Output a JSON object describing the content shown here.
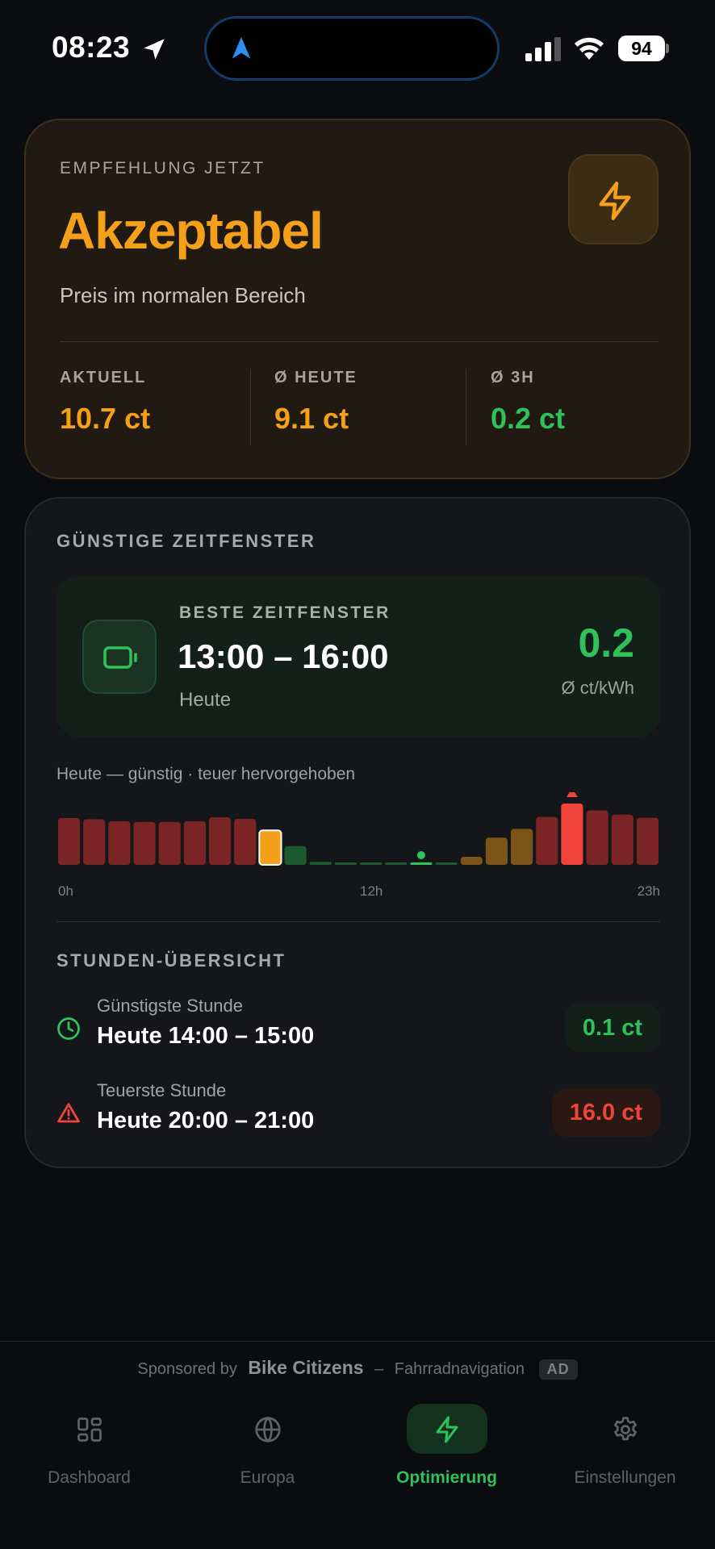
{
  "status_bar": {
    "time": "08:23",
    "battery": "94"
  },
  "recommendation": {
    "label": "EMPFEHLUNG JETZT",
    "status": "Akzeptabel",
    "description": "Preis im normalen Bereich",
    "stats": [
      {
        "label": "AKTUELL",
        "value": "10.7 ct",
        "color": "#f5a01a"
      },
      {
        "label": "Ø HEUTE",
        "value": "9.1 ct",
        "color": "#f5a01a"
      },
      {
        "label": "Ø 3H",
        "value": "0.2 ct",
        "color": "#2fc25a"
      }
    ]
  },
  "windows": {
    "title": "GÜNSTIGE ZEITFENSTER",
    "best": {
      "label": "BESTE ZEITFENSTER",
      "time": "13:00 – 16:00",
      "day": "Heute",
      "value": "0.2",
      "unit": "Ø ct/kWh"
    },
    "chart_caption": "Heute — günstig · teuer hervorgehoben",
    "chart_data": {
      "type": "bar",
      "categories": [
        "0h",
        "1h",
        "2h",
        "3h",
        "4h",
        "5h",
        "6h",
        "7h",
        "8h",
        "9h",
        "10h",
        "11h",
        "12h",
        "13h",
        "14h",
        "15h",
        "16h",
        "17h",
        "18h",
        "19h",
        "20h",
        "21h",
        "22h",
        "23h"
      ],
      "values": [
        12.2,
        11.9,
        11.4,
        11.2,
        11.2,
        11.4,
        12.4,
        12.0,
        9.0,
        4.9,
        0.8,
        0.4,
        0.4,
        0.6,
        0.1,
        0.5,
        2.1,
        7.1,
        9.4,
        12.5,
        16.0,
        14.2,
        13.1,
        12.3
      ],
      "highlight_current": "8h",
      "highlight_cheapest": "14h",
      "highlight_expensive": "20h",
      "x_tick_labels": [
        "0h",
        "12h",
        "23h"
      ],
      "colors": {
        "expensive": "#7a2426",
        "peak": "#f0443a",
        "current": "#f5a01a",
        "mid": "#7a5418",
        "cheap": "#1e5a2f",
        "cheapest": "#2fc25a"
      }
    },
    "hours_title": "STUNDEN-ÜBERSICHT",
    "cheapest": {
      "label": "Günstigste Stunde",
      "time": "Heute 14:00 – 15:00",
      "value": "0.1 ct"
    },
    "expensive": {
      "label": "Teuerste Stunde",
      "time": "Heute 20:00 – 21:00",
      "value": "16.0 ct"
    }
  },
  "sponsor": {
    "prefix": "Sponsored by",
    "brand": "Bike Citizens",
    "dash": "–",
    "tagline": "Fahrradnavigation",
    "ad": "AD"
  },
  "tabs": [
    {
      "label": "Dashboard",
      "icon": "dashboard-icon"
    },
    {
      "label": "Europa",
      "icon": "globe-icon"
    },
    {
      "label": "Optimierung",
      "icon": "bolt-icon",
      "active": true
    },
    {
      "label": "Einstellungen",
      "icon": "gear-icon"
    }
  ]
}
